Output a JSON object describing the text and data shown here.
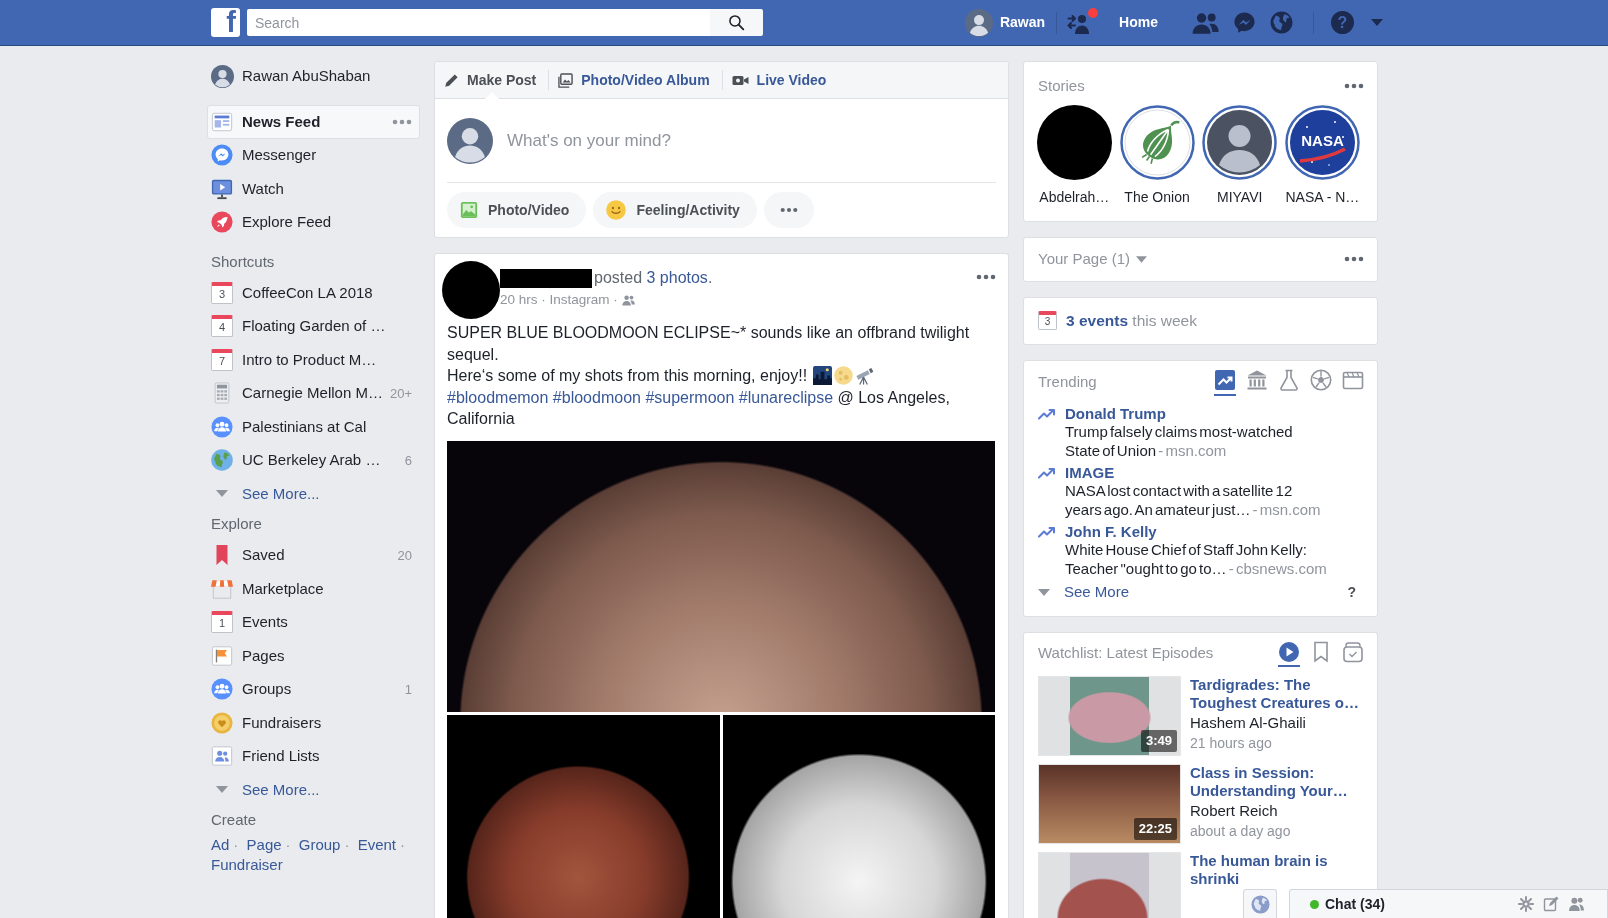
{
  "topbar": {
    "logo": "f",
    "search": {
      "placeholder": "Search"
    },
    "profile_name": "Rawan",
    "friend_requests": {
      "unread": true
    },
    "home_link": "Home",
    "help": "?"
  },
  "sidebar": {
    "profile": {
      "name": "Rawan AbuShaban"
    },
    "main_items": [
      {
        "kind": "news-feed",
        "label": "News Feed",
        "selected": true
      },
      {
        "kind": "messenger",
        "label": "Messenger",
        "selected": false
      },
      {
        "kind": "watch",
        "label": "Watch",
        "selected": false
      },
      {
        "kind": "explore",
        "label": "Explore Feed",
        "selected": false
      }
    ],
    "sections": [
      {
        "heading": "Shortcuts",
        "items": [
          {
            "kind": "calendar",
            "day": "3",
            "label": "CoffeeCon LA 2018"
          },
          {
            "kind": "calendar",
            "day": "4",
            "label": "Floating Garden of …"
          },
          {
            "kind": "calendar",
            "day": "7",
            "label": "Intro to Product M…"
          },
          {
            "kind": "calculator",
            "label": "Carnegie Mellon M…",
            "count": "20+"
          },
          {
            "kind": "group",
            "label": "Palestinians at Cal"
          },
          {
            "kind": "earth",
            "label": "UC Berkeley Arab …",
            "count": "6"
          }
        ],
        "see_more": "See More..."
      },
      {
        "heading": "Explore",
        "items": [
          {
            "kind": "saved",
            "label": "Saved",
            "count": "20"
          },
          {
            "kind": "marketplace",
            "label": "Marketplace"
          },
          {
            "kind": "calendar",
            "day": "1",
            "label": "Events"
          },
          {
            "kind": "pages",
            "label": "Pages"
          },
          {
            "kind": "group",
            "label": "Groups",
            "count": "1"
          },
          {
            "kind": "fundraisers",
            "label": "Fundraisers"
          },
          {
            "kind": "friend-lists",
            "label": "Friend Lists"
          }
        ],
        "see_more": "See More..."
      }
    ],
    "create": {
      "heading": "Create",
      "links": [
        "Ad",
        "Page",
        "Group",
        "Event",
        "Fundraiser"
      ],
      "separator": "·"
    }
  },
  "composer": {
    "tabs": [
      {
        "kind": "post",
        "label": "Make Post",
        "selected": true
      },
      {
        "kind": "album",
        "label": "Photo/Video Album",
        "selected": false
      },
      {
        "kind": "live",
        "label": "Live Video",
        "selected": false
      }
    ],
    "placeholder": "What's on your mind?",
    "actions": [
      {
        "kind": "photo",
        "label": "Photo/Video"
      },
      {
        "kind": "feeling",
        "label": "Feeling/Activity"
      },
      {
        "kind": "more"
      }
    ]
  },
  "post": {
    "headline": {
      "before": "posted",
      "link": "3 photos",
      "after": "."
    },
    "time": "20 hrs",
    "source": "Instagram",
    "separator": "·",
    "lines": [
      {
        "text": "SUPER BLUE BLOODMOON ECLIPSE~* sounds like an offbrand twilight sequel.",
        "emojis": false
      },
      {
        "text": "Here‘s some of my shots from this morning, enjoy!!",
        "emojis": true
      }
    ],
    "hashtags": [
      "#bloodmemon",
      "#bloodmoon",
      "#supermoon",
      "#lunareclipse"
    ],
    "location": "@ Los Angeles, California",
    "photos": [
      {
        "kind": "copper"
      },
      {
        "kind": "red"
      },
      {
        "kind": "silver"
      }
    ]
  },
  "stories": {
    "title": "Stories",
    "items": [
      {
        "kind": "hidden",
        "name": "Abdelrah…"
      },
      {
        "kind": "onion",
        "name": "The Onion"
      },
      {
        "kind": "person",
        "name": "MIYAVI"
      },
      {
        "kind": "nasa",
        "name": "NASA - N…",
        "logo_text": "NASA"
      }
    ]
  },
  "your_page": {
    "title": "Your Page (1)"
  },
  "events": {
    "day": "3",
    "link": "3 events",
    "text": "this week"
  },
  "trending": {
    "title": "Trending",
    "tabs": [
      {
        "kind": "top",
        "selected": true
      },
      {
        "kind": "politics",
        "selected": false
      },
      {
        "kind": "science",
        "selected": false
      },
      {
        "kind": "sports",
        "selected": false
      },
      {
        "kind": "entertainment",
        "selected": false
      }
    ],
    "separator": "-",
    "items": [
      {
        "topic": "Donald Trump",
        "headline": "Trump falsely claims most-watched State of Union",
        "source": "msn.com"
      },
      {
        "topic": "IMAGE",
        "headline": "NASA lost contact with a satellite 12 years ago. An amateur just…",
        "source": "msn.com"
      },
      {
        "topic": "John F. Kelly",
        "headline": "White House Chief of Staff John Kelly: Teacher \"ought to go to…",
        "source": "cbsnews.com"
      }
    ],
    "see_more": "See More",
    "help": "?"
  },
  "watchlist": {
    "title": "Watchlist: Latest Episodes",
    "tabs": [
      {
        "kind": "videos",
        "selected": true
      },
      {
        "kind": "saved",
        "selected": false
      },
      {
        "kind": "archive",
        "selected": false
      }
    ],
    "episodes": [
      {
        "kind": "tardigrade",
        "title": "Tardigrades: The Toughest Creatures o…",
        "author": "Hashem Al-Ghaili",
        "time": "21 hours ago",
        "duration": "3:49"
      },
      {
        "kind": "lecture",
        "title": "Class in Session: Understanding Your…",
        "author": "Robert Reich",
        "time": "about a day ago",
        "duration": "22:25"
      },
      {
        "kind": "brain",
        "title": "The human brain is shrinki"
      }
    ]
  },
  "chat": {
    "label": "Chat (34)",
    "online": true
  }
}
